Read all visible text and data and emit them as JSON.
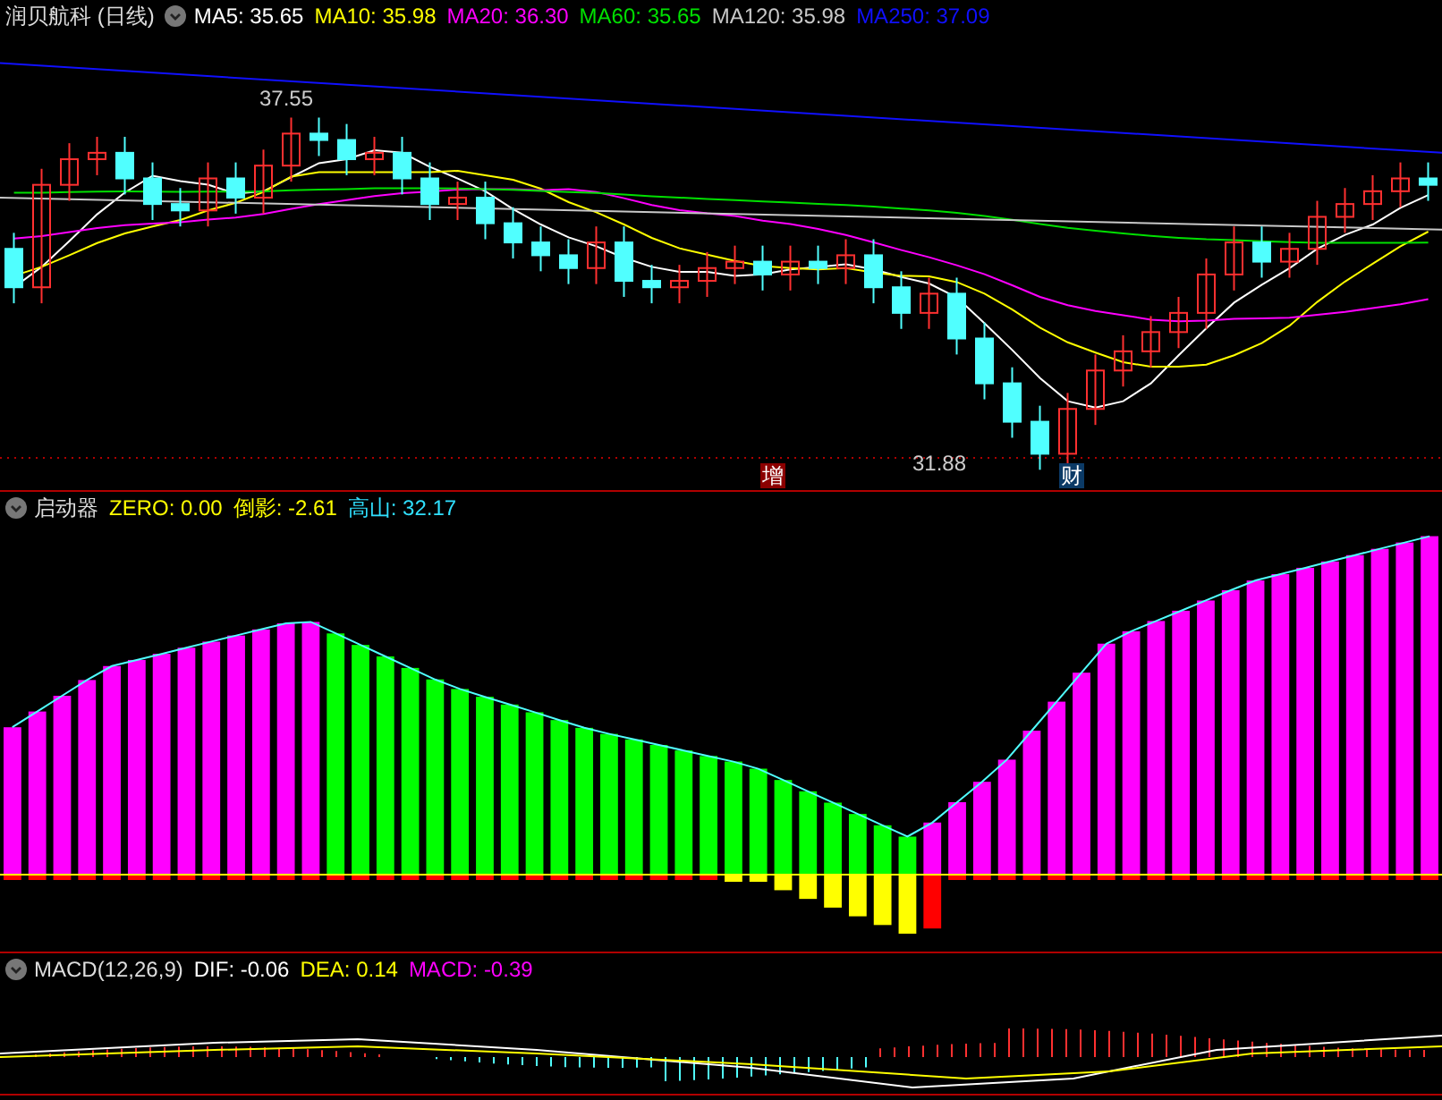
{
  "title": "润贝航科 (日线)",
  "ma_legend": [
    {
      "label": "MA5: 35.65",
      "color": "#ffffff"
    },
    {
      "label": "MA10: 35.98",
      "color": "#ffff00"
    },
    {
      "label": "MA20: 36.30",
      "color": "#ff00ff"
    },
    {
      "label": "MA60: 35.65",
      "color": "#00e000"
    },
    {
      "label": "MA120: 35.98",
      "color": "#c8c8c8"
    },
    {
      "label": "MA250: 37.09",
      "color": "#1010ff"
    }
  ],
  "price_labels": [
    "37.55",
    "31.88"
  ],
  "markers": [
    {
      "text": "增",
      "color": "#8b0000"
    },
    {
      "text": "财",
      "color": "#0b3a66"
    }
  ],
  "indicator": {
    "name": "启动器",
    "legend": [
      {
        "label": "ZERO: 0.00",
        "color": "#ffff00"
      },
      {
        "label": "倒影: -2.61",
        "color": "#ffff00"
      },
      {
        "label": "高山: 32.17",
        "color": "#30e0ff"
      }
    ]
  },
  "macd": {
    "name": "MACD(12,26,9)",
    "legend": [
      {
        "label": "DIF: -0.06",
        "color": "#ffffff"
      },
      {
        "label": "DEA: 0.14",
        "color": "#ffff00"
      },
      {
        "label": "MACD: -0.39",
        "color": "#ff00ff"
      }
    ]
  }
}
